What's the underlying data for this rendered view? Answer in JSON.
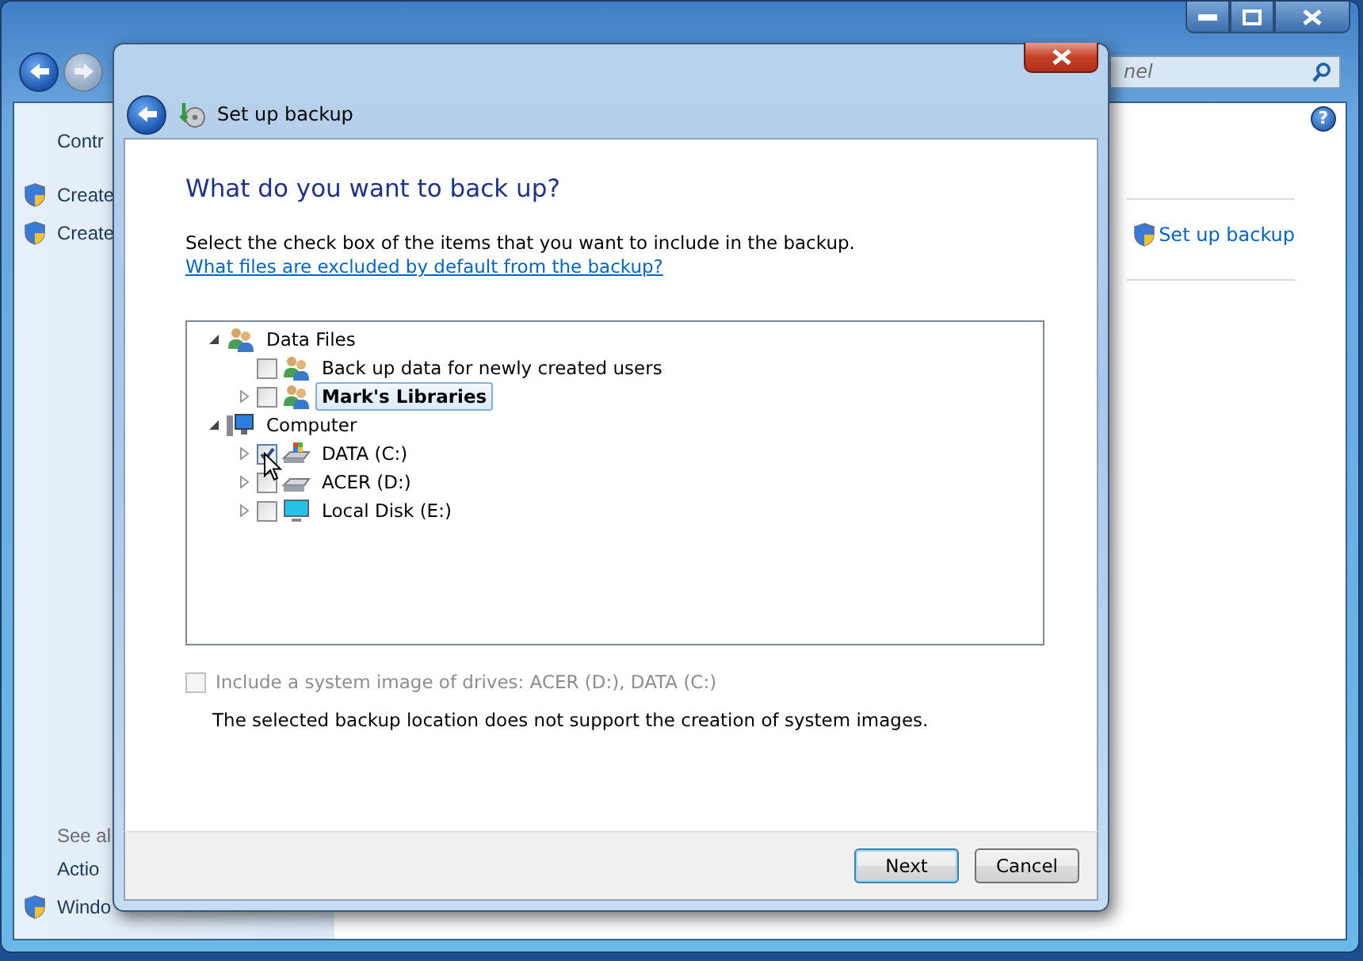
{
  "background_window": {
    "search": {
      "placeholder": "nel"
    },
    "help": "?",
    "sidebar": {
      "items": [
        {
          "label": "Contr",
          "kind": "plain"
        },
        {
          "label": "Create",
          "kind": "shield"
        },
        {
          "label": "Create",
          "kind": "shield"
        }
      ]
    },
    "see_also": {
      "title": "See al",
      "items": [
        {
          "label": "Actio",
          "kind": "plain"
        },
        {
          "label": "Windo",
          "kind": "shield"
        }
      ]
    },
    "main_link": {
      "label": "Set up backup",
      "kind": "shield"
    }
  },
  "dialog": {
    "title": "Set up backup",
    "heading": "What do you want to back up?",
    "instruction": "Select the check box of the items that you want to include in the backup.",
    "instruction_link": "What files are excluded by default from the backup?",
    "tree": [
      {
        "label": "Data Files",
        "kind": "users",
        "expanded": true,
        "selected": false,
        "children": [
          {
            "label": "Back up data for newly created users",
            "kind": "users",
            "checked": false,
            "selected": false
          },
          {
            "label": "Mark's Libraries",
            "kind": "users",
            "expanded": false,
            "checked": false,
            "selected": true
          }
        ]
      },
      {
        "label": "Computer",
        "kind": "computer",
        "expanded": true,
        "selected": false,
        "children": [
          {
            "label": "DATA (C:)",
            "kind": "system-drive",
            "expanded": false,
            "checked": true,
            "selected": false
          },
          {
            "label": "ACER (D:)",
            "kind": "drive",
            "expanded": false,
            "checked": false,
            "selected": false
          },
          {
            "label": "Local Disk (E:)",
            "kind": "display",
            "expanded": false,
            "checked": false,
            "selected": false
          }
        ]
      }
    ],
    "system_image": {
      "label": "Include a system image of drives: ACER (D:), DATA (C:)",
      "checked": false,
      "disabled": true
    },
    "note": "The selected backup location does not support the creation of system images.",
    "buttons": [
      {
        "label": "Next",
        "default": true
      },
      {
        "label": "Cancel",
        "default": false
      }
    ]
  }
}
